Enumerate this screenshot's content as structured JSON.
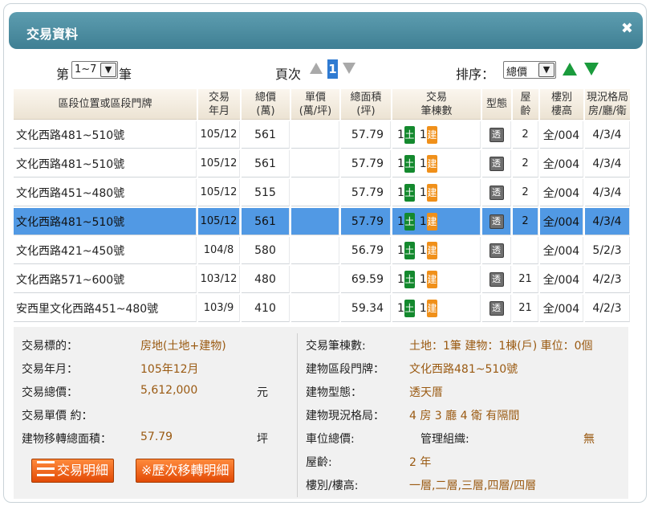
{
  "dialog": {
    "title": "交易資料",
    "close_label": "✖"
  },
  "toolbar": {
    "range_prefix": "第",
    "range_value": "1~7",
    "range_suffix": "筆",
    "page_label": "頁次",
    "current_page": "1",
    "sort_label": "排序：",
    "sort_value": "總價"
  },
  "table": {
    "headers": {
      "addr": "區段位置或區段門牌",
      "ym": [
        "交易",
        "年月"
      ],
      "total": [
        "總價",
        "(萬)"
      ],
      "unit": [
        "單價",
        "(萬/坪)"
      ],
      "area": [
        "總面積",
        "(坪)"
      ],
      "count": [
        "交易",
        "筆棟數"
      ],
      "type": "型態",
      "age": [
        "屋",
        "齡"
      ],
      "floor": [
        "樓別",
        "樓高"
      ],
      "layout": [
        "現況格局",
        "房/廳/衛"
      ]
    },
    "land_badge": "土",
    "bldg_badge": "建",
    "type_icon": "透",
    "rows": [
      {
        "addr": "文化西路481~510號",
        "ym": "105/12",
        "total": "561",
        "unit": "",
        "area": "57.79",
        "land": "1",
        "bldg": "1",
        "age": "2",
        "floor": "全/004",
        "layout": "4/3/4"
      },
      {
        "addr": "文化西路481~510號",
        "ym": "105/12",
        "total": "561",
        "unit": "",
        "area": "57.79",
        "land": "1",
        "bldg": "1",
        "age": "2",
        "floor": "全/004",
        "layout": "4/3/4"
      },
      {
        "addr": "文化西路451~480號",
        "ym": "105/12",
        "total": "515",
        "unit": "",
        "area": "57.79",
        "land": "1",
        "bldg": "1",
        "age": "2",
        "floor": "全/004",
        "layout": "4/3/4"
      },
      {
        "addr": "文化西路481~510號",
        "ym": "105/12",
        "total": "561",
        "unit": "",
        "area": "57.79",
        "land": "1",
        "bldg": "1",
        "age": "2",
        "floor": "全/004",
        "layout": "4/3/4"
      },
      {
        "addr": "文化西路421~450號",
        "ym": "104/8",
        "total": "580",
        "unit": "",
        "area": "56.79",
        "land": "1",
        "bldg": "1",
        "age": "",
        "floor": "全/004",
        "layout": "5/2/3"
      },
      {
        "addr": "文化西路571~600號",
        "ym": "103/12",
        "total": "480",
        "unit": "",
        "area": "69.59",
        "land": "1",
        "bldg": "1",
        "age": "21",
        "floor": "全/004",
        "layout": "4/2/3"
      },
      {
        "addr": "安西里文化西路451~480號",
        "ym": "103/9",
        "total": "410",
        "unit": "",
        "area": "59.34",
        "land": "1",
        "bldg": "1",
        "age": "21",
        "floor": "全/004",
        "layout": "4/2/3"
      }
    ],
    "selected_row": 3,
    "selected_color": "#5199e4"
  },
  "detail": {
    "target_label": "交易標的：",
    "target_value": "房地(土地+建物)",
    "ym_label": "交易年月：",
    "ym_value": "105年12月",
    "total_label": "交易總價：",
    "total_value": "5,612,000",
    "total_unit": "元",
    "unit_label": "交易單價 約：",
    "area_label": "建物移轉總面積：",
    "area_value": "57.79",
    "area_unit": "坪",
    "count_label": "交易筆棟數:",
    "count_value": "土地：1筆 建物：1棟(戶) 車位：0個",
    "door_label": "建物區段門牌：",
    "door_value": "文化西路481~510號",
    "type_label": "建物型態：",
    "type_value": "透天厝",
    "layout_label": "建物現況格局：",
    "layout_value": "4 房 3 廳 4 衛 有隔間",
    "parking_label": "車位總價:",
    "mgmt_label": "管理組織:",
    "mgmt_value": "無",
    "age_label": "屋齡:",
    "age_value": "2 年",
    "floor_label": "樓別/樓高:",
    "floor_value": "一層,二層,三層,四層/四層",
    "btn_detail": "交易明細",
    "btn_history": "※歷次移轉明細"
  },
  "colors": {
    "title_bar": "#4a8ca0",
    "land_badge": "#14892e",
    "bldg_badge": "#f0901a",
    "value_text": "#9a5a12",
    "button": "#e85a10"
  }
}
